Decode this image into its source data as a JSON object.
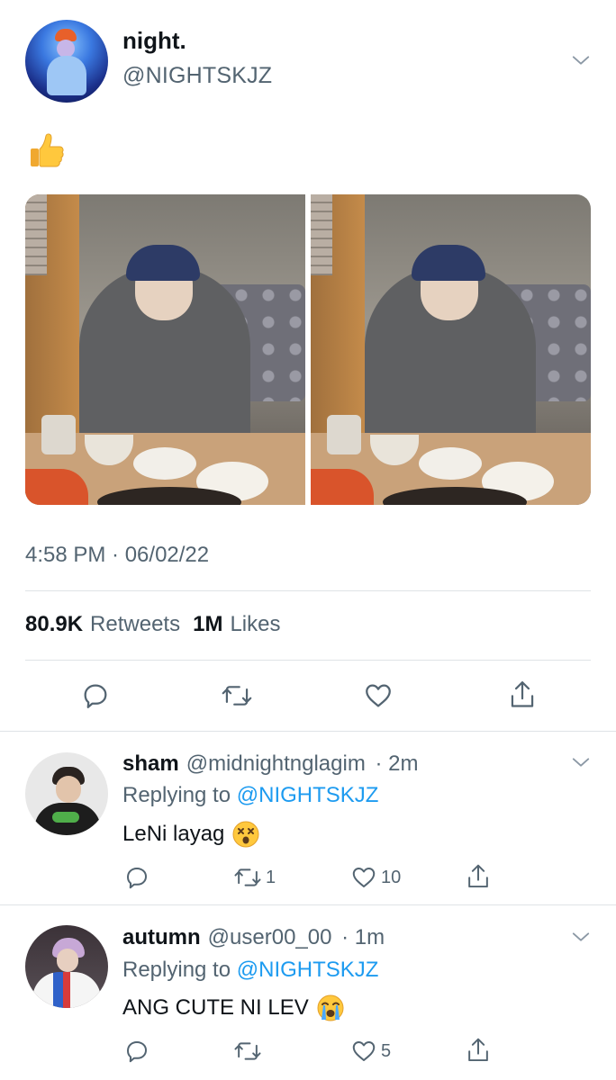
{
  "tweet": {
    "author": {
      "name": "night.",
      "handle": "@NIGHTSKJZ"
    },
    "emoji": "thumbs-up",
    "timestamp": "4:58 PM · 06/02/22",
    "stats": {
      "retweets_count": "80.9K",
      "retweets_label": "Retweets",
      "likes_count": "1M",
      "likes_label": "Likes"
    },
    "photos": [
      {
        "description_icon": "photo-1"
      },
      {
        "description_icon": "photo-2"
      }
    ]
  },
  "replies": [
    {
      "name": "sham",
      "handle": "@midnightnglagim",
      "time": "· 2m",
      "replying_label": "Replying to",
      "replying_to": "@NIGHTSKJZ",
      "text": "LeNi layag",
      "emoji": "dizzy-face",
      "retweets": "1",
      "likes": "10"
    },
    {
      "name": "autumn",
      "handle": "@user00_00",
      "time": "· 1m",
      "replying_label": "Replying to",
      "replying_to": "@NIGHTSKJZ",
      "text": "ANG CUTE NI LEV",
      "emoji": "loudly-crying-face",
      "retweets": "",
      "likes": "5"
    }
  ],
  "colors": {
    "text": "#0f1419",
    "secondary": "#536471",
    "link": "#1d9bf0",
    "divider": "#dfe3e6"
  }
}
